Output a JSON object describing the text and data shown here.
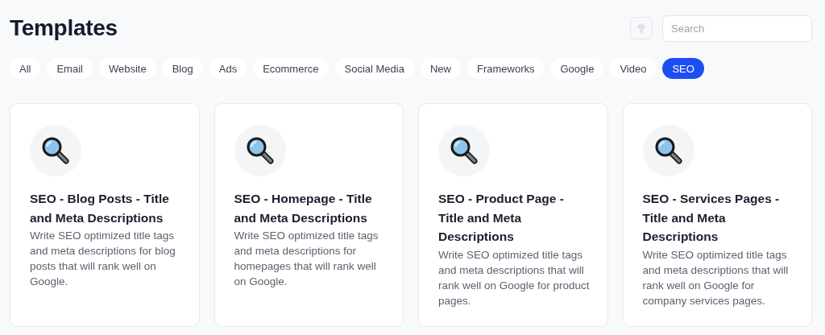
{
  "title": "Templates",
  "search": {
    "placeholder": "Search"
  },
  "filters": [
    {
      "label": "All",
      "selected": false
    },
    {
      "label": "Email",
      "selected": false
    },
    {
      "label": "Website",
      "selected": false
    },
    {
      "label": "Blog",
      "selected": false
    },
    {
      "label": "Ads",
      "selected": false
    },
    {
      "label": "Ecommerce",
      "selected": false
    },
    {
      "label": "Social Media",
      "selected": false
    },
    {
      "label": "New",
      "selected": false
    },
    {
      "label": "Frameworks",
      "selected": false
    },
    {
      "label": "Google",
      "selected": false
    },
    {
      "label": "Video",
      "selected": false
    },
    {
      "label": "SEO",
      "selected": true
    }
  ],
  "cards": [
    {
      "title": "SEO - Blog Posts - Title and Meta Descriptions",
      "description": "Write SEO optimized title tags and meta descriptions for blog posts that will rank well on Google."
    },
    {
      "title": "SEO - Homepage - Title and Meta Descriptions",
      "description": "Write SEO optimized title tags and meta descriptions for homepages that will rank well on Google."
    },
    {
      "title": "SEO - Product Page - Title and Meta Descriptions",
      "description": "Write SEO optimized title tags and meta descriptions that will rank well on Google for product pages."
    },
    {
      "title": "SEO - Services Pages - Title and Meta Descriptions",
      "description": "Write SEO optimized title tags and meta descriptions that will rank well on Google for company services pages."
    }
  ]
}
